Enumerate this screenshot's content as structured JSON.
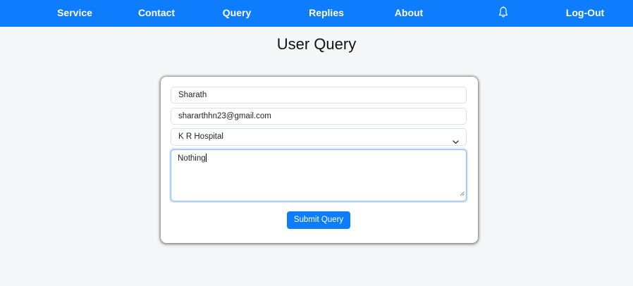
{
  "navbar": {
    "items": [
      {
        "label": "Service"
      },
      {
        "label": "Contact"
      },
      {
        "label": "Query"
      },
      {
        "label": "Replies"
      },
      {
        "label": "About"
      }
    ],
    "notification_icon": "bell-icon",
    "logout_label": "Log-Out"
  },
  "page": {
    "title": "User Query"
  },
  "form": {
    "name_value": "Sharath",
    "email_value": "shararthhn23@gmail.com",
    "hospital_selected": "K R Hospital",
    "message_value": "Nothing",
    "submit_label": "Submit Query"
  },
  "colors": {
    "primary": "#0d7dfd",
    "background": "#f5f6f8",
    "card": "#ffffff",
    "focus_border": "#86b7fe"
  }
}
